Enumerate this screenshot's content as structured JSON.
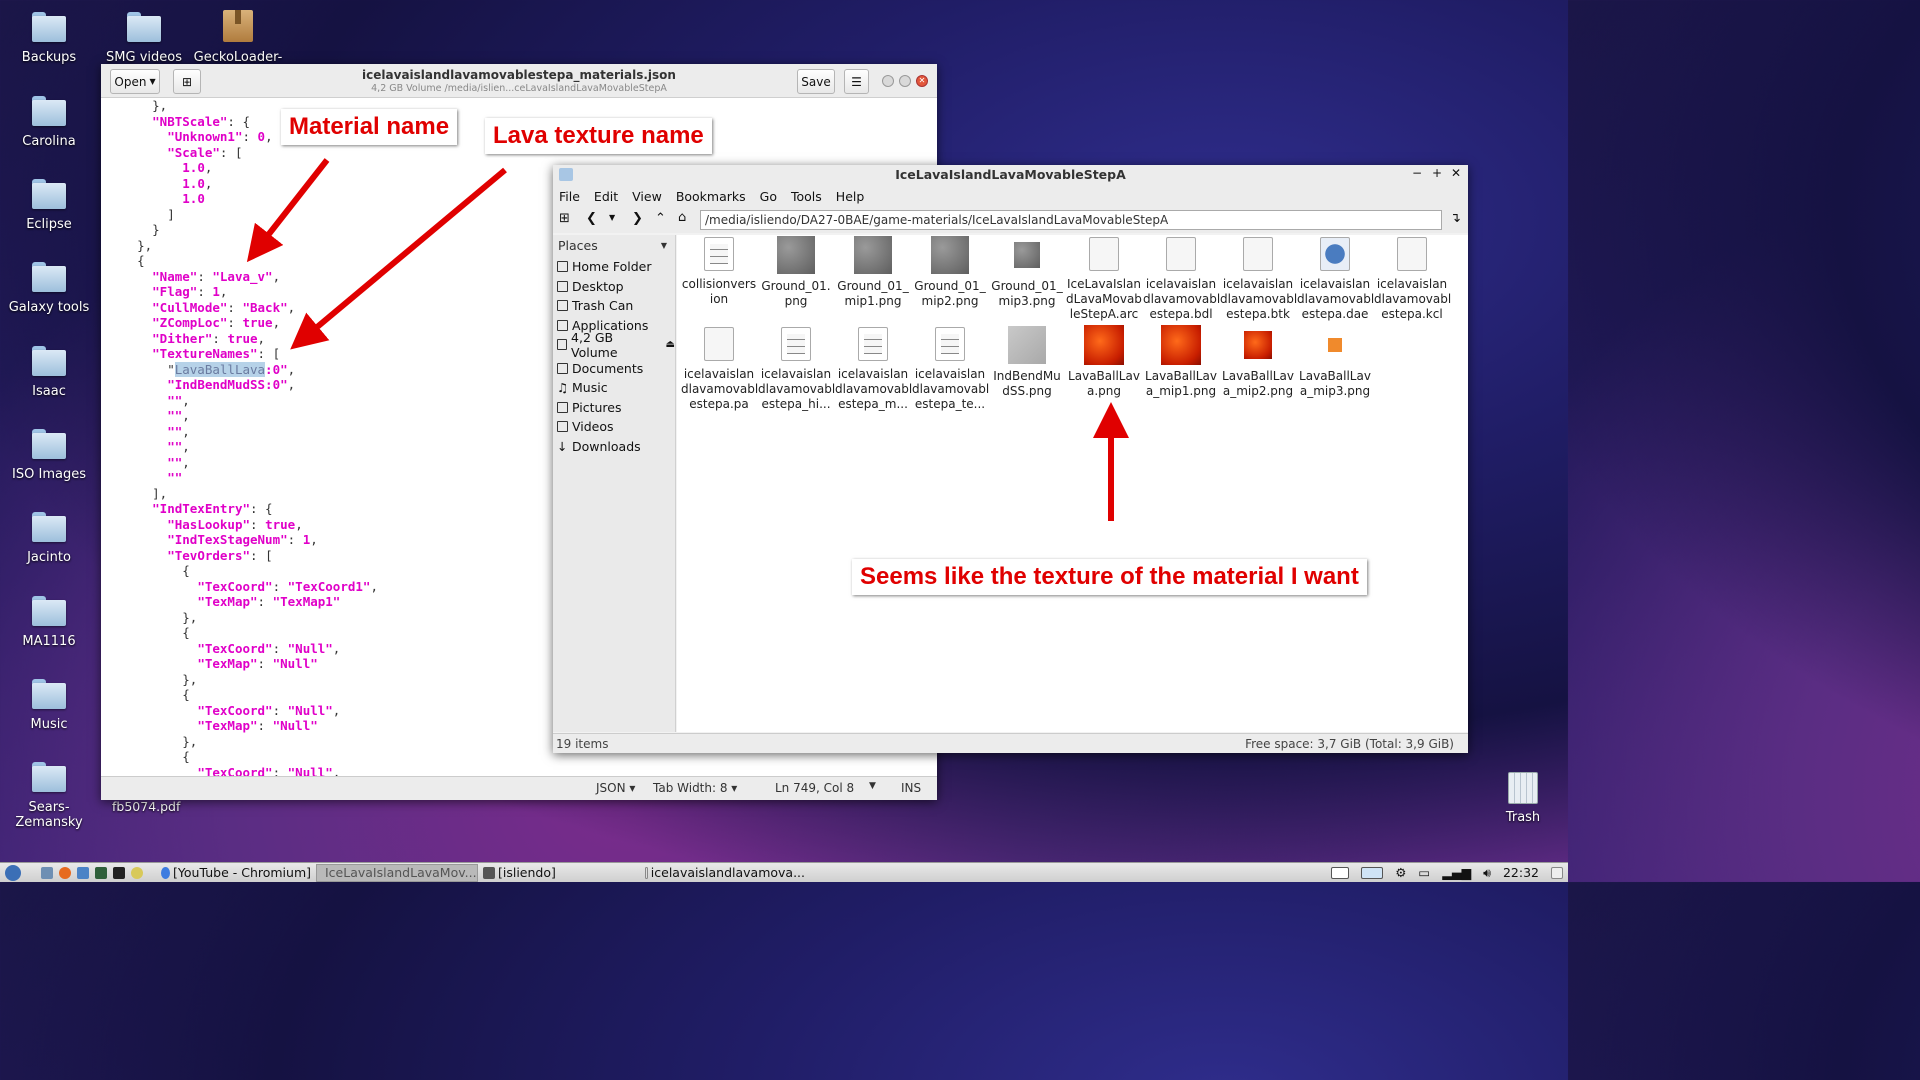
{
  "desktop": {
    "icons": [
      {
        "label": "Backups"
      },
      {
        "label": "SMG videos"
      },
      {
        "label": "GeckoLoader-"
      },
      {
        "label": "Carolina"
      },
      {
        "label": "Eclipse"
      },
      {
        "label": "Galaxy tools"
      },
      {
        "label": "Isaac"
      },
      {
        "label": "ISO Images"
      },
      {
        "label": "Jacinto"
      },
      {
        "label": "MA1116"
      },
      {
        "label": "Music"
      },
      {
        "label": "Sears-\nZemansky"
      }
    ],
    "pdf_label": "fb5074.pdf",
    "trash_label": "Trash"
  },
  "editor": {
    "open_label": "Open",
    "save_label": "Save",
    "title": "icelavaislandlavamovablestepa_materials.json",
    "subtitle": "4,2 GB Volume /media/islien...ceLavaIslandLavaMovableStepA",
    "status": {
      "lang": "JSON",
      "tab": "Tab Width: 8",
      "pos": "Ln 749, Col 8",
      "mode": "INS"
    },
    "lines": [
      "      },",
      "      \"NBTScale\": {",
      "        \"Unknown1\": 0,",
      "        \"Scale\": [",
      "          1.0,",
      "          1.0,",
      "          1.0",
      "        ]",
      "      }",
      "    },",
      "    {",
      "      \"Name\": \"Lava_v\",",
      "      \"Flag\": 1,",
      "      \"CullMode\": \"Back\",",
      "      \"ZCompLoc\": true,",
      "      \"Dither\": true,",
      "      \"TextureNames\": [",
      "        \"LavaBallLava:0\",",
      "        \"IndBendMudSS:0\",",
      "        \"\",",
      "        \"\",",
      "        \"\",",
      "        \"\",",
      "        \"\",",
      "        \"\"",
      "      ],",
      "      \"IndTexEntry\": {",
      "        \"HasLookup\": true,",
      "        \"IndTexStageNum\": 1,",
      "        \"TevOrders\": [",
      "          {",
      "            \"TexCoord\": \"TexCoord1\",",
      "            \"TexMap\": \"TexMap1\"",
      "          },",
      "          {",
      "            \"TexCoord\": \"Null\",",
      "            \"TexMap\": \"Null\"",
      "          },",
      "          {",
      "            \"TexCoord\": \"Null\",",
      "            \"TexMap\": \"Null\"",
      "          },",
      "          {",
      "            \"TexCoord\": \"Null\","
    ]
  },
  "callouts": {
    "material": "Material name",
    "lava": "Lava texture name",
    "texture": "Seems like the texture of the material I want"
  },
  "filemanager": {
    "title": "IceLavaIslandLavaMovableStepA",
    "menu": [
      "File",
      "Edit",
      "View",
      "Bookmarks",
      "Go",
      "Tools",
      "Help"
    ],
    "path": "/media/isliendo/DA27-0BAE/game-materials/IceLavaIslandLavaMovableStepA",
    "places_label": "Places",
    "places": [
      "Home Folder",
      "Desktop",
      "Trash Can",
      "Applications",
      "4,2 GB Volume",
      "Documents",
      "Music",
      "Pictures",
      "Videos",
      "Downloads"
    ],
    "files": [
      "collisionvers ion",
      "Ground_01. png",
      "Ground_01_ mip1.png",
      "Ground_01_ mip2.png",
      "Ground_01_ mip3.png",
      "IceLavaIslan dLavaMovab leStepA.arc",
      "icelavaislan dlavamovabl estepa.bdl",
      "icelavaislan dlavamovabl estepa.btk",
      "icelavaislan dlavamovabl estepa.dae",
      "icelavaislan dlavamovabl estepa.kcl",
      "icelavaislan dlavamovabl estepa.pa",
      "icelavaislan dlavamovabl estepa_hi...",
      "icelavaislan dlavamovabl estepa_m...",
      "icelavaislan dlavamovabl estepa_te...",
      "IndBendMu dSS.png",
      "LavaBallLav a.png",
      "LavaBallLav a_mip1.png",
      "LavaBallLav a_mip2.png",
      "LavaBallLav a_mip3.png"
    ],
    "status_left": "19 items",
    "status_right": "Free space: 3,7 GiB (Total: 3,9 GiB)"
  },
  "taskbar": {
    "items": [
      "[YouTube - Chromium]",
      "IceLavaIslandLavaMov...",
      "[isliendo]",
      "icelavaislandlavamova..."
    ],
    "clock": "22:32"
  }
}
